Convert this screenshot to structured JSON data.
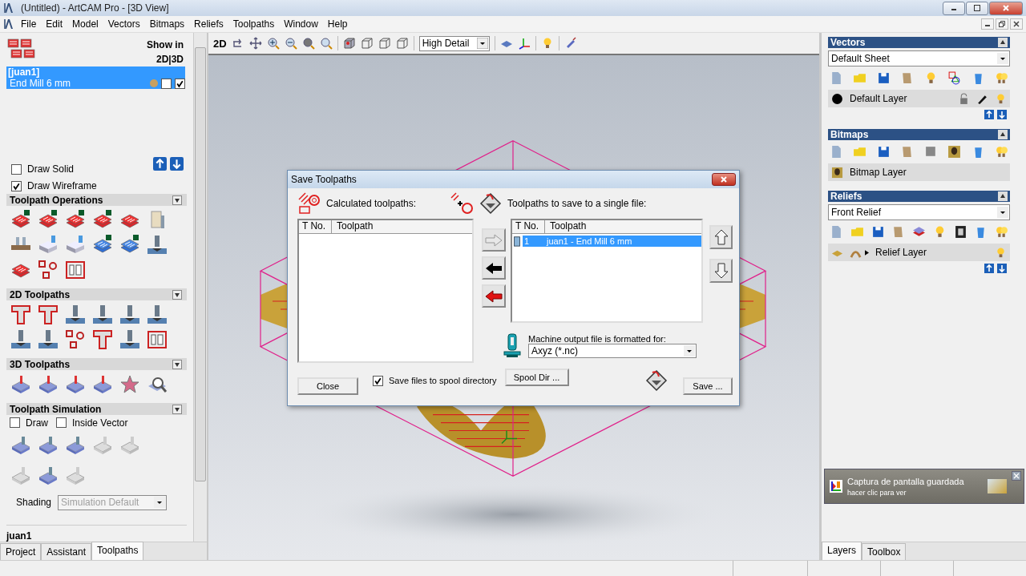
{
  "window": {
    "title": "(Untitled) - ArtCAM Pro - [3D View]"
  },
  "menu": [
    "File",
    "Edit",
    "Model",
    "Vectors",
    "Bitmaps",
    "Reliefs",
    "Toolpaths",
    "Window",
    "Help"
  ],
  "toolpaths_panel": {
    "show_in_label": "Show in",
    "show_in_modes": "2D|3D",
    "group": "[juan1]",
    "items": [
      {
        "name": "End Mill 6 mm",
        "selected": true,
        "show_2d": false,
        "show_3d": true
      }
    ],
    "draw_solid": {
      "label": "Draw Solid",
      "checked": false
    },
    "draw_wireframe": {
      "label": "Draw Wireframe",
      "checked": true
    },
    "sections": [
      {
        "title": "Toolpath Operations"
      },
      {
        "title": "2D Toolpaths"
      },
      {
        "title": "3D Toolpaths"
      }
    ],
    "simulation": {
      "title": "Toolpath Simulation",
      "draw": {
        "label": "Draw",
        "checked": false
      },
      "inside_vector": {
        "label": "Inside Vector",
        "checked": false
      },
      "shading_label": "Shading",
      "shading_value": "Simulation Default",
      "shading_disabled": true
    },
    "current": "juan1"
  },
  "left_tabs": [
    {
      "label": "Project",
      "selected": false
    },
    {
      "label": "Assistant",
      "selected": false
    },
    {
      "label": "Toolpaths",
      "selected": true
    }
  ],
  "view_toolbar": {
    "mode": "2D",
    "detail": "High Detail"
  },
  "right_panel": {
    "vectors": {
      "title": "Vectors",
      "sheet": "Default Sheet",
      "layer": "Default Layer"
    },
    "bitmaps": {
      "title": "Bitmaps",
      "layer": "Bitmap Layer"
    },
    "reliefs": {
      "title": "Reliefs",
      "relief": "Front Relief",
      "layer": "Relief Layer"
    }
  },
  "notification": {
    "title": "Captura de pantalla guardada",
    "text": "hacer clic para ver"
  },
  "right_tabs": [
    {
      "label": "Layers",
      "selected": true
    },
    {
      "label": "Toolbox",
      "selected": false
    }
  ],
  "dialog": {
    "title": "Save Toolpaths",
    "calculated_label": "Calculated toolpaths:",
    "save_label": "Toolpaths to save to a single file:",
    "left_columns": [
      "T No.",
      "Toolpath"
    ],
    "right_columns": [
      "T No.",
      "Toolpath"
    ],
    "save_rows": [
      {
        "number": "1",
        "toolpath": "juan1 - End Mill 6 mm",
        "selected": true
      }
    ],
    "add_disabled": true,
    "machine_label": "Machine output file is formatted for:",
    "machine_format": "Axyz (*.nc)",
    "spool": {
      "label": "Save files to spool directory",
      "checked": true
    },
    "close": "Close",
    "spool_dir": "Spool Dir ...",
    "save": "Save ..."
  }
}
